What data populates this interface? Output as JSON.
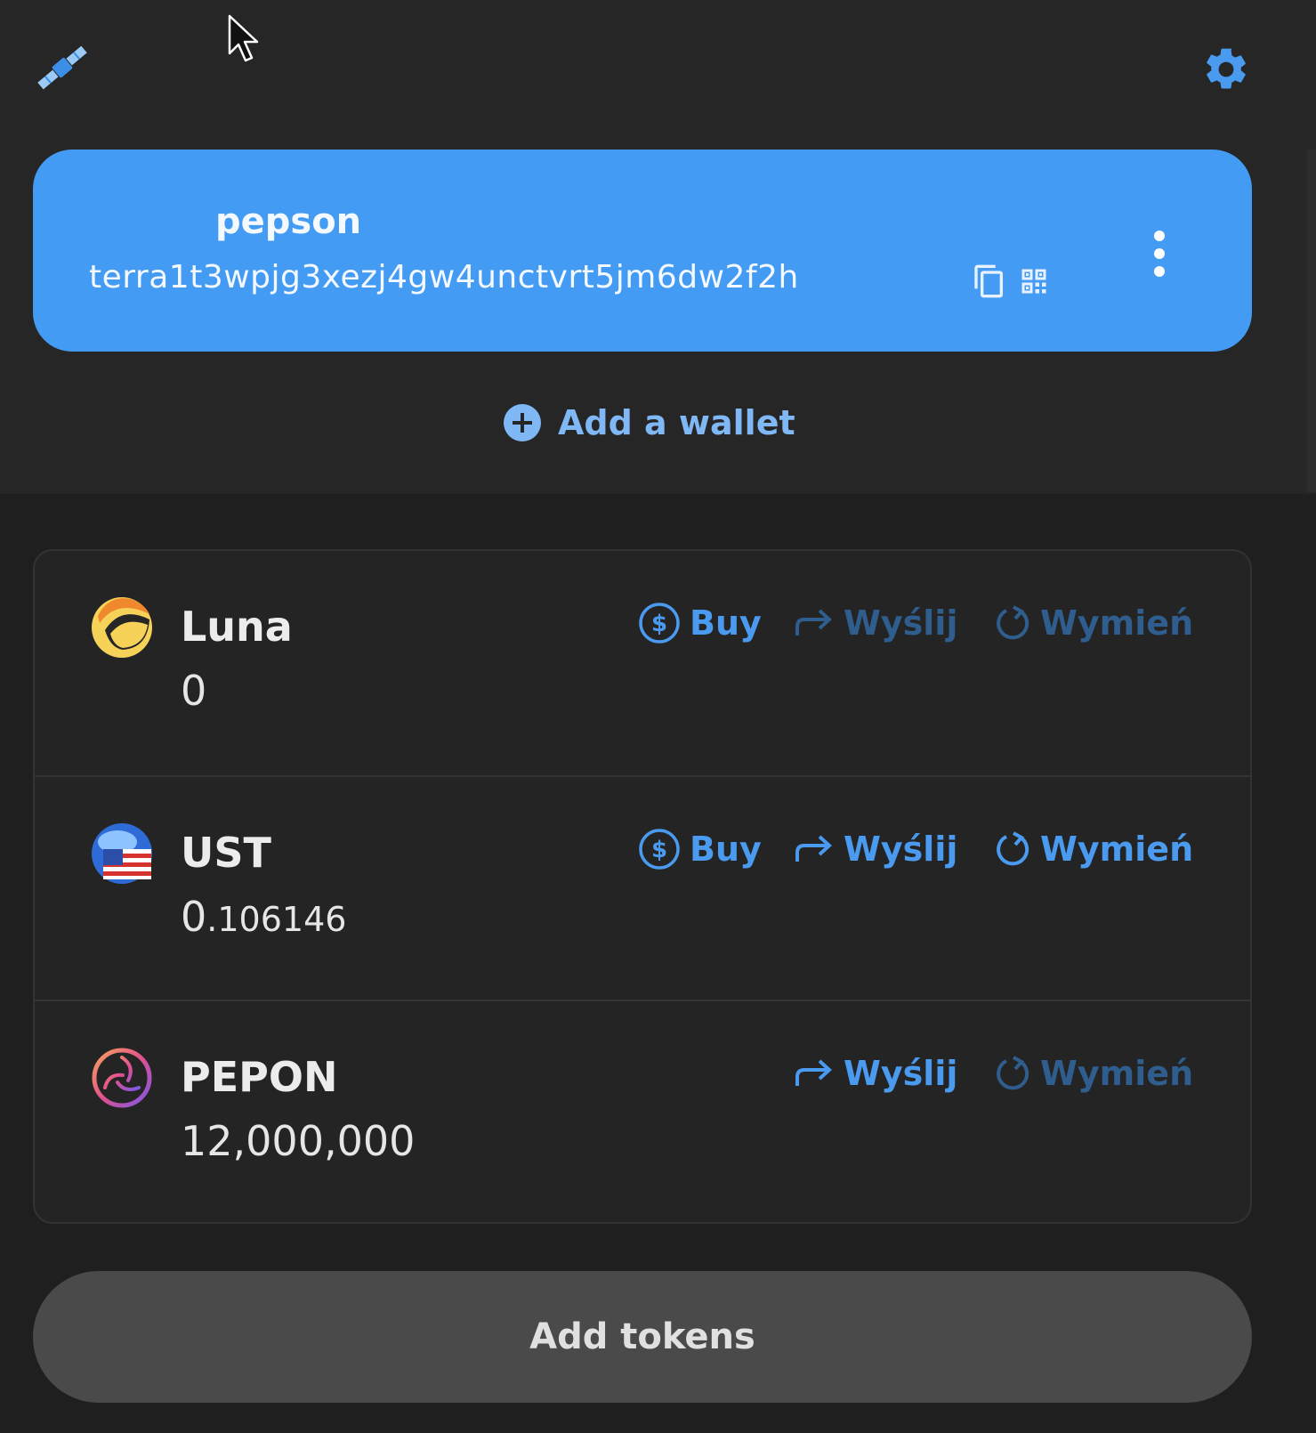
{
  "icons": {
    "logo": "satellite-icon",
    "settings": "gear-icon",
    "copy": "copy-icon",
    "qr": "qr-code-icon",
    "menu": "vertical-dots-icon",
    "add": "plus-circle-icon",
    "buy": "dollar-circle-icon",
    "send": "arrow-forward-icon",
    "swap": "refresh-icon"
  },
  "colors": {
    "accent": "#439bf3",
    "link": "#4a9af0",
    "link_disabled": "#2f5d8d",
    "background": "#1f1f1f"
  },
  "wallet": {
    "name": "pepson",
    "address": "terra1t3wpjg3xezj4gw4unctvrt5jm6dw2f2h"
  },
  "add_wallet_label": "Add a wallet",
  "tokens": [
    {
      "name": "Luna",
      "balance_int": "0",
      "balance_dec": "",
      "buy": "Buy",
      "send": "Wyślij",
      "swap": "Wymień",
      "send_enabled": false,
      "swap_enabled": false
    },
    {
      "name": "UST",
      "balance_int": "0",
      "balance_dec": ".106146",
      "buy": "Buy",
      "send": "Wyślij",
      "swap": "Wymień",
      "send_enabled": true,
      "swap_enabled": true
    },
    {
      "name": "PEPON",
      "balance_int": "12,000,000",
      "balance_dec": "",
      "send": "Wyślij",
      "swap": "Wymień",
      "send_enabled": true,
      "swap_enabled": false
    }
  ],
  "add_tokens_label": "Add tokens"
}
